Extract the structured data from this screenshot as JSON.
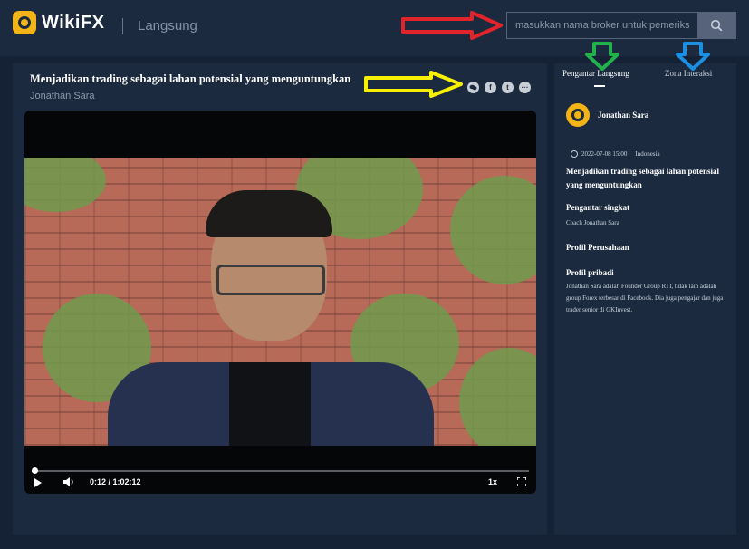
{
  "brand": {
    "name": "WikiFX"
  },
  "header": {
    "page_label": "Langsung",
    "search": {
      "placeholder": "masukkan nama broker untuk pemeriksa",
      "button_icon": "search-icon"
    }
  },
  "stream": {
    "title": "Menjadikan trading sebagai lahan potensial yang menguntungkan",
    "author": "Jonathan Sara",
    "share_icons": [
      "wechat-icon",
      "facebook-icon",
      "twitter-icon",
      "more-icon"
    ],
    "share_glyphs": {
      "facebook": "f",
      "twitter": "t",
      "more": "···"
    }
  },
  "player": {
    "time": "0:12 / 1:02:12",
    "progress_fraction": 0.003,
    "speed": "1x"
  },
  "sidebar": {
    "tabs": [
      {
        "label": "Pengantar Langsung",
        "active": true
      },
      {
        "label": "Zona Interaksi",
        "active": false
      }
    ],
    "host": {
      "name": "Jonathan Sara"
    },
    "meta": {
      "datetime": "2022-07-08 15:00",
      "country": "Indonesia"
    },
    "title": "Menjadikan trading sebagai lahan potensial yang menguntungkan",
    "sections": [
      {
        "heading": "Pengantar singkat",
        "body": "Coach Jonathan Sara"
      },
      {
        "heading": "Profil Perusahaan",
        "body": ""
      },
      {
        "heading": "Profil pribadi",
        "body": "Jonathan Sara adalah Founder Group RTI, tidak lain adalah group Forex terbesar di Facebook. Dia juga pengajar dan juga trader senior di GKInvest."
      }
    ]
  },
  "annotations": {
    "colors": {
      "red": "#e0242a",
      "yellow": "#f7f000",
      "green": "#22b14c",
      "blue": "#1c8fe0"
    }
  }
}
